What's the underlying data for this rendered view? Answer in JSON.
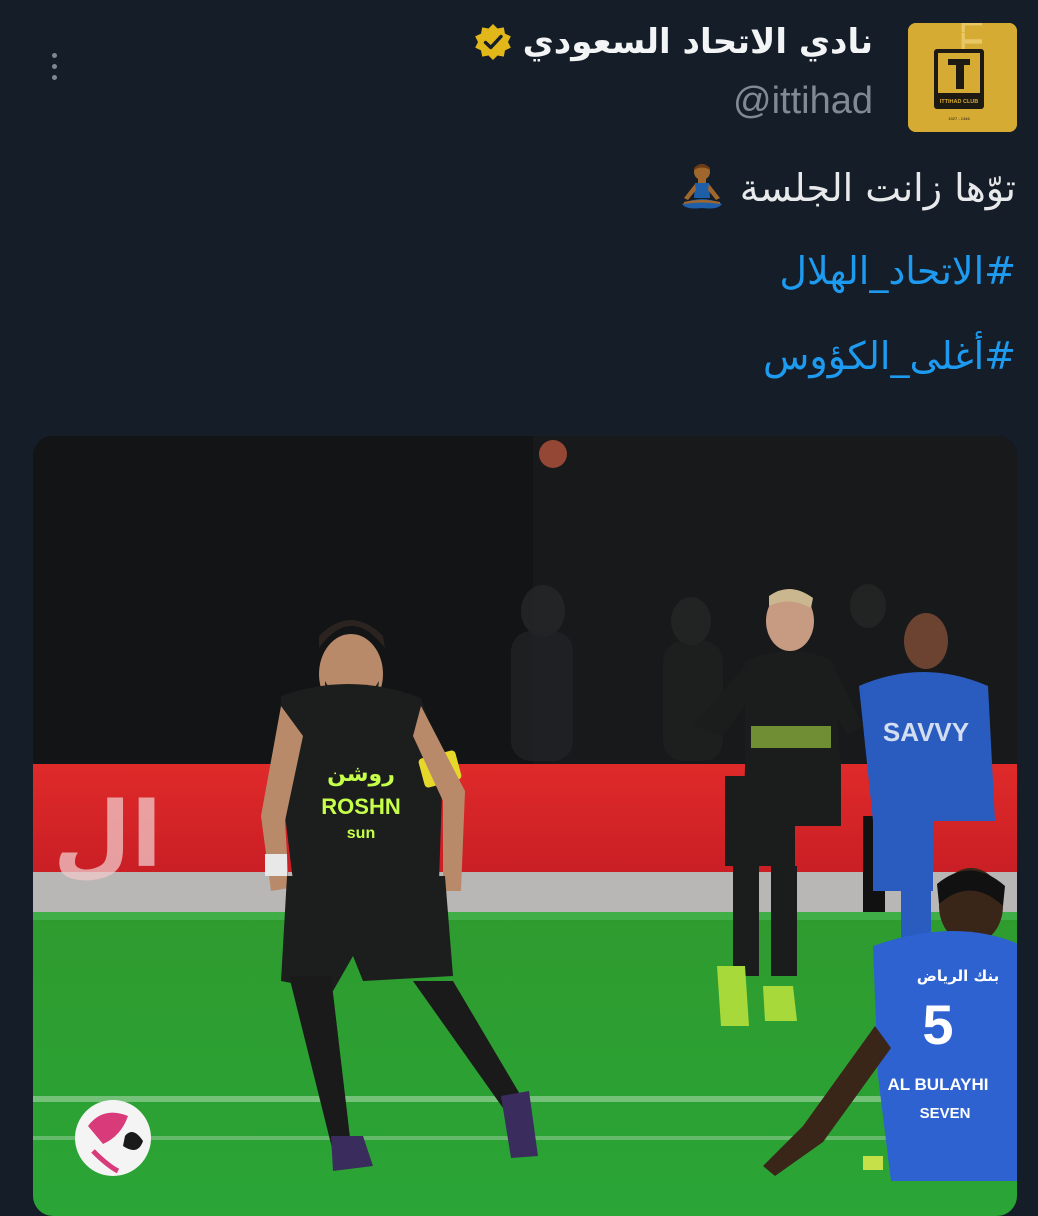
{
  "tweet": {
    "author_name": "نادي الاتحاد السعودي",
    "handle": "@ittihad",
    "text": "توّها زانت الجلسة",
    "hashtags": [
      "#الاتحاد_الهلال",
      "#أغلى_الكؤوس"
    ]
  },
  "avatar": {
    "logo_text": "ITTIHAD CLUB",
    "logo_year": "1927 - 1346",
    "background_text": "ITTIHAD"
  },
  "media": {
    "board_text": "ال",
    "player1": {
      "sponsor_arabic": "روشن",
      "sponsor_latin": "ROSHN",
      "secondary_sponsor": "sun"
    },
    "player3": {
      "number": "5",
      "name": "AL BULAYHI",
      "sponsor_arabic": "بنك الرياض",
      "sleeve_sponsor": "SEVEN"
    },
    "player4": {
      "sponsor": "SAVVY"
    }
  },
  "icons": {
    "more": "more-vertical-icon",
    "verified": "verified-badge-icon",
    "emoji": "person-in-lotus-position-emoji"
  },
  "colors": {
    "background": "#151d28",
    "hashtag": "#1d9bf0",
    "verified": "#e2b719",
    "avatar": "#d6ab33"
  }
}
